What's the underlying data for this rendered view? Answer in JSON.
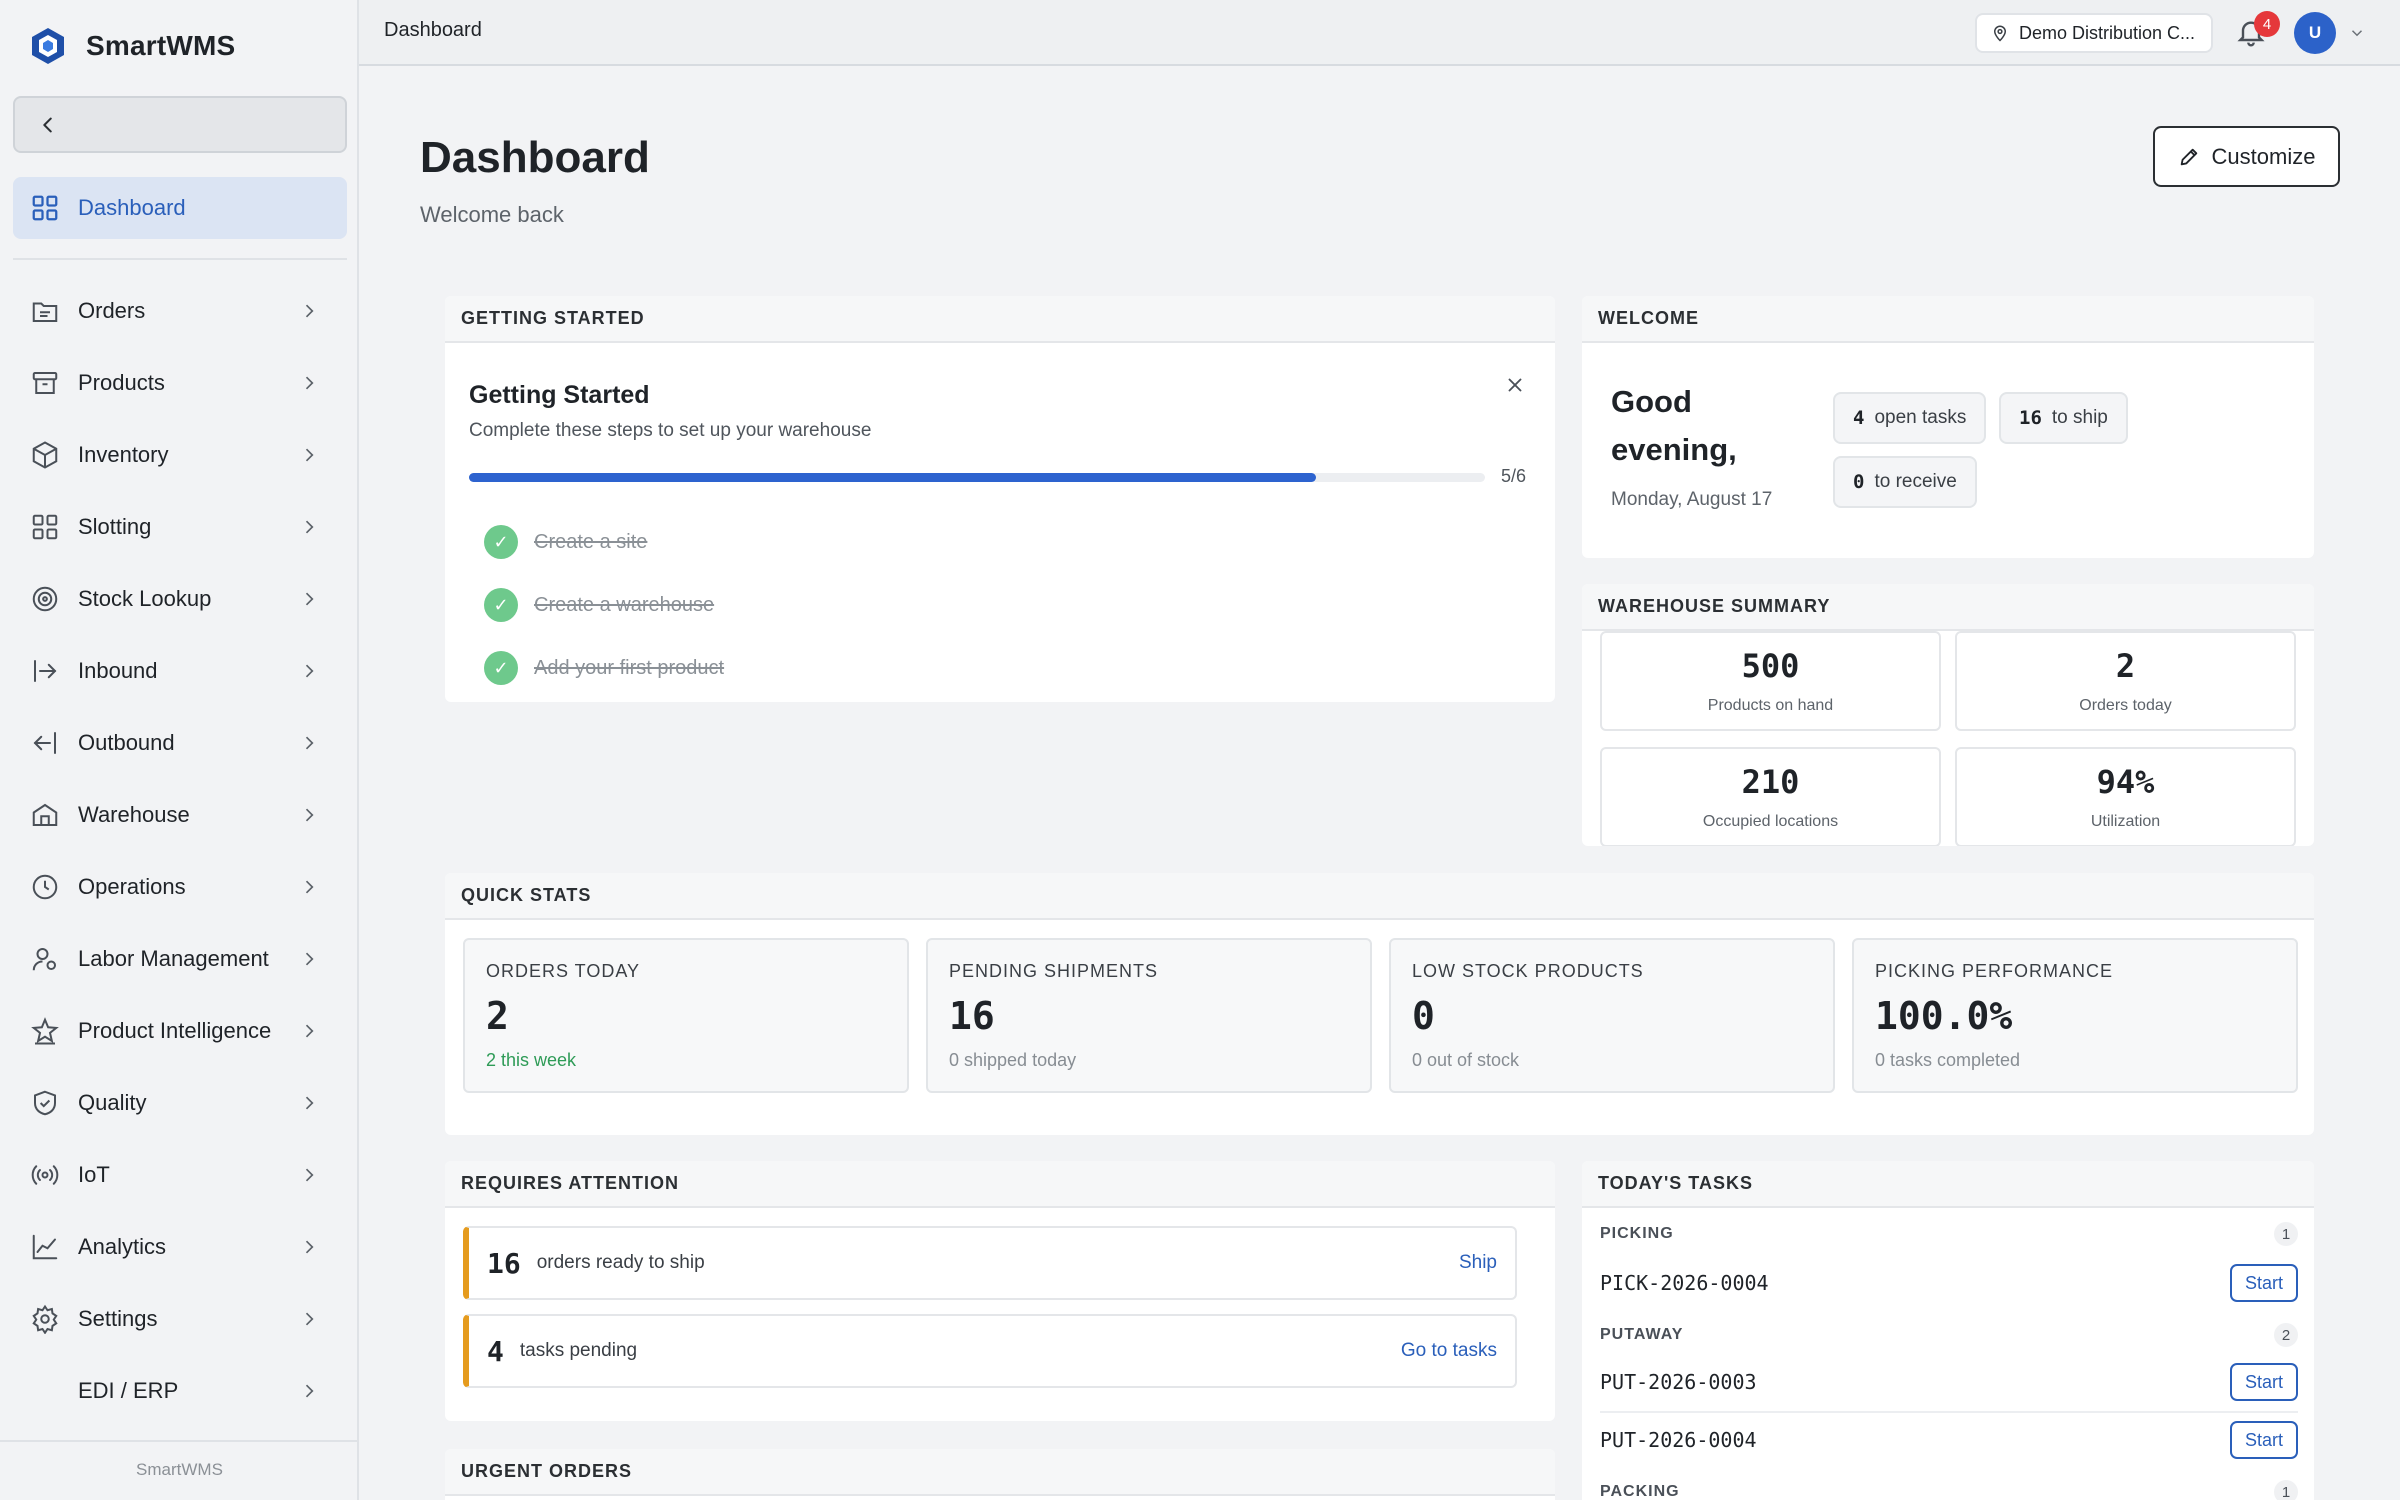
{
  "app": {
    "name": "SmartWMS",
    "footer": "SmartWMS"
  },
  "colors": {
    "accent": "#2a5fba",
    "success": "#2e9b57",
    "warning": "#e59b1e",
    "badge": "#e5383b"
  },
  "sidebar": {
    "active": {
      "label": "Dashboard",
      "icon": "grid-icon"
    },
    "items": [
      {
        "label": "Orders",
        "icon": "orders-icon"
      },
      {
        "label": "Products",
        "icon": "archive-box-icon"
      },
      {
        "label": "Inventory",
        "icon": "cube-icon"
      },
      {
        "label": "Slotting",
        "icon": "grid-icon"
      },
      {
        "label": "Stock Lookup",
        "icon": "target-icon"
      },
      {
        "label": "Inbound",
        "icon": "arrow-in-icon"
      },
      {
        "label": "Outbound",
        "icon": "arrow-out-icon"
      },
      {
        "label": "Warehouse",
        "icon": "building-icon"
      },
      {
        "label": "Operations",
        "icon": "clock-icon"
      },
      {
        "label": "Labor Management",
        "icon": "user-gear-icon"
      },
      {
        "label": "Product Intelligence",
        "icon": "award-icon"
      },
      {
        "label": "Quality",
        "icon": "shield-check-icon"
      },
      {
        "label": "IoT",
        "icon": "broadcast-icon"
      },
      {
        "label": "Analytics",
        "icon": "line-chart-icon"
      },
      {
        "label": "Settings",
        "icon": "gear-icon"
      },
      {
        "label": "EDI / ERP",
        "icon": ""
      }
    ]
  },
  "topbar": {
    "title": "Dashboard",
    "site": "Demo Distribution C...",
    "notifications": "4",
    "avatar": "U"
  },
  "header": {
    "title": "Dashboard",
    "subtitle": "Welcome back",
    "customize_label": "Customize"
  },
  "getting_started": {
    "section": "GETTING STARTED",
    "title": "Getting Started",
    "subtitle": "Complete these steps to set up your warehouse",
    "progress": 0.8333,
    "count": "5/6",
    "steps": [
      "Create a site",
      "Create a warehouse",
      "Add your first product"
    ]
  },
  "welcome": {
    "section": "WELCOME",
    "greeting": "Good evening,",
    "date": "Monday, August 17",
    "chips": [
      {
        "num": "4",
        "text": "open tasks"
      },
      {
        "num": "16",
        "text": "to ship"
      },
      {
        "num": "0",
        "text": "to receive"
      }
    ]
  },
  "summary": {
    "section": "WAREHOUSE SUMMARY",
    "tiles": [
      {
        "value": "500",
        "caption": "Products on hand"
      },
      {
        "value": "2",
        "caption": "Orders today"
      },
      {
        "value": "210",
        "caption": "Occupied locations"
      },
      {
        "value": "94%",
        "caption": "Utilization"
      }
    ]
  },
  "quick_stats": {
    "section": "QUICK STATS",
    "cards": [
      {
        "label": "ORDERS TODAY",
        "value": "2",
        "note": "2 this week"
      },
      {
        "label": "PENDING SHIPMENTS",
        "value": "16",
        "note": "0 shipped today"
      },
      {
        "label": "LOW STOCK PRODUCTS",
        "value": "0",
        "note": "0 out of stock"
      },
      {
        "label": "PICKING PERFORMANCE",
        "value": "100.0%",
        "note": "0 tasks completed"
      }
    ]
  },
  "attention": {
    "section": "REQUIRES ATTENTION",
    "rows": [
      {
        "num": "16",
        "text": "orders ready to ship",
        "action": "Ship"
      },
      {
        "num": "4",
        "text": "tasks pending",
        "action": "Go to tasks"
      }
    ]
  },
  "urgent": {
    "section": "URGENT ORDERS"
  },
  "tasks": {
    "section": "TODAY'S TASKS",
    "start_label": "Start",
    "groups": [
      {
        "name": "PICKING",
        "count": "1",
        "items": [
          "PICK-2026-0004"
        ]
      },
      {
        "name": "PUTAWAY",
        "count": "2",
        "items": [
          "PUT-2026-0003",
          "PUT-2026-0004"
        ]
      },
      {
        "name": "PACKING",
        "count": "1",
        "items": []
      }
    ]
  }
}
